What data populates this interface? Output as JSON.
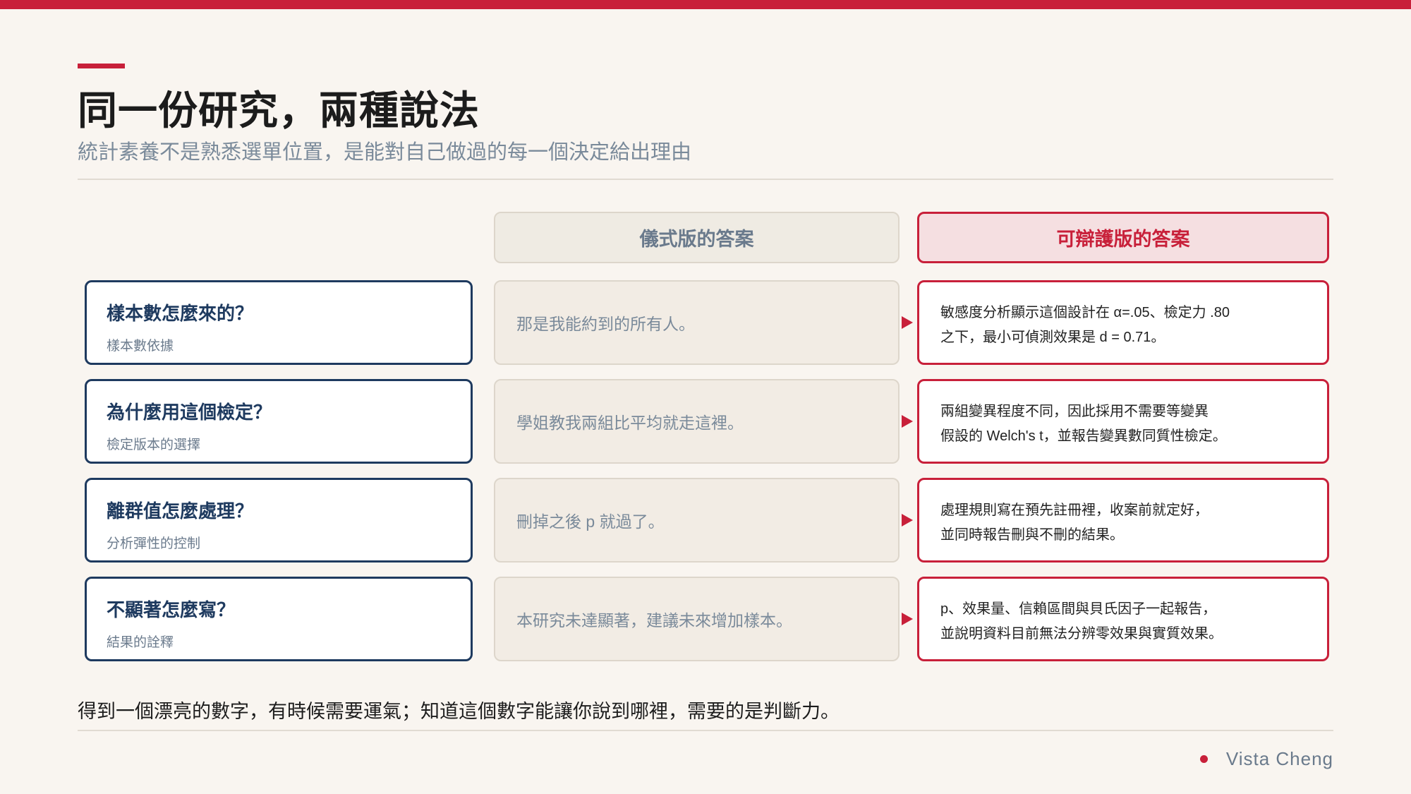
{
  "slide": {
    "title": "同一份研究，兩種說法",
    "subtitle": "統計素養不是熟悉選單位置，是能對自己做過的每一個決定給出理由",
    "columns": {
      "ritual": "儀式版的答案",
      "defensible": "可辯護版的答案"
    },
    "rows": [
      {
        "question": "樣本數怎麼來的？",
        "topic": "樣本數依據",
        "ritual": "那是我能約到的所有人。",
        "defensible": [
          "敏感度分析顯示這個設計在 α=.05、檢定力 .80",
          "之下，最小可偵測效果是 d = 0.71。"
        ]
      },
      {
        "question": "為什麼用這個檢定？",
        "topic": "檢定版本的選擇",
        "ritual": "學姐教我兩組比平均就走這裡。",
        "defensible": [
          "兩組變異程度不同，因此採用不需要等變異",
          "假設的 Welch's t，並報告變異數同質性檢定。"
        ]
      },
      {
        "question": "離群值怎麼處理？",
        "topic": "分析彈性的控制",
        "ritual": "刪掉之後 p 就過了。",
        "defensible": [
          "處理規則寫在預先註冊裡，收案前就定好，",
          "並同時報告刪與不刪的結果。"
        ]
      },
      {
        "question": "不顯著怎麼寫？",
        "topic": "結果的詮釋",
        "ritual": "本研究未達顯著，建議未來增加樣本。",
        "defensible": [
          "p、效果量、信賴區間與貝氏因子一起報告，",
          "並說明資料目前無法分辨零效果與實質效果。"
        ]
      }
    ],
    "conclusion": "得到一個漂亮的數字，有時候需要運氣；知道這個數字能讓你說到哪裡，需要的是判斷力。",
    "author": "Vista Cheng",
    "colors": {
      "accent": "#c8203a",
      "navy": "#1e3a5f",
      "background": "#f9f5f0"
    }
  }
}
